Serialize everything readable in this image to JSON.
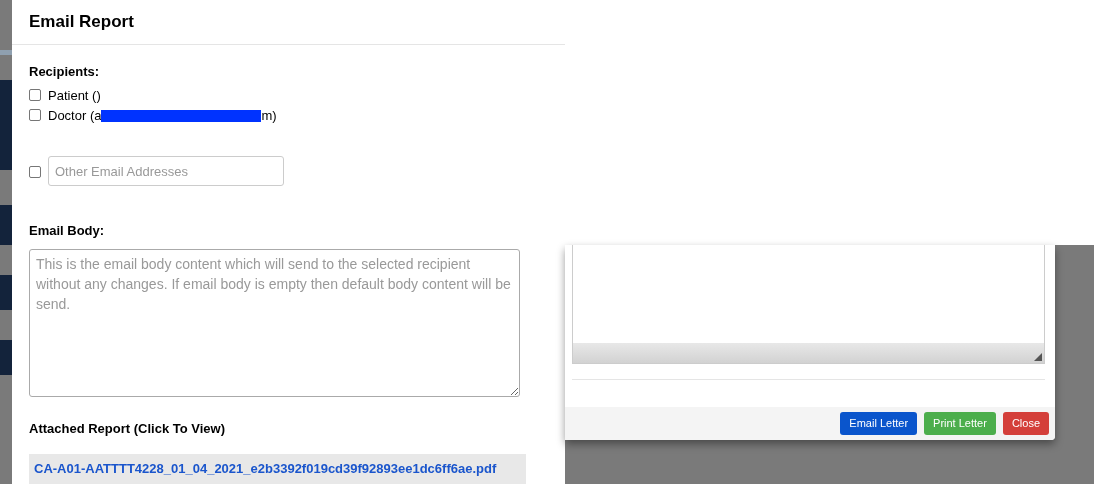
{
  "email_modal": {
    "title": "Email Report",
    "recipients_label": "Recipients:",
    "recipients": [
      {
        "label": "Patient ()",
        "checked": false,
        "redacted": false
      },
      {
        "label": "Doctor (a",
        "label_end": "m)",
        "checked": false,
        "redacted": true
      }
    ],
    "other_email": {
      "checked": false,
      "placeholder": "Other Email Addresses"
    },
    "body_label": "Email Body:",
    "body_placeholder": "This is the email body content which will send to the selected recipient without any changes. If email body is empty then default body content will be send.",
    "attachment_label": "Attached Report (Click To View)",
    "attachment_link": "CA-A01-AATTTT4228_01_04_2021_e2b3392f019cd39f92893ee1dc6ff6ae.pdf"
  },
  "letter_window": {
    "buttons": [
      {
        "label": "Email Letter",
        "color": "#0a55cc"
      },
      {
        "label": "Print Letter",
        "color": "#4cae4c"
      },
      {
        "label": "Close",
        "color": "#d43f3a"
      }
    ]
  }
}
